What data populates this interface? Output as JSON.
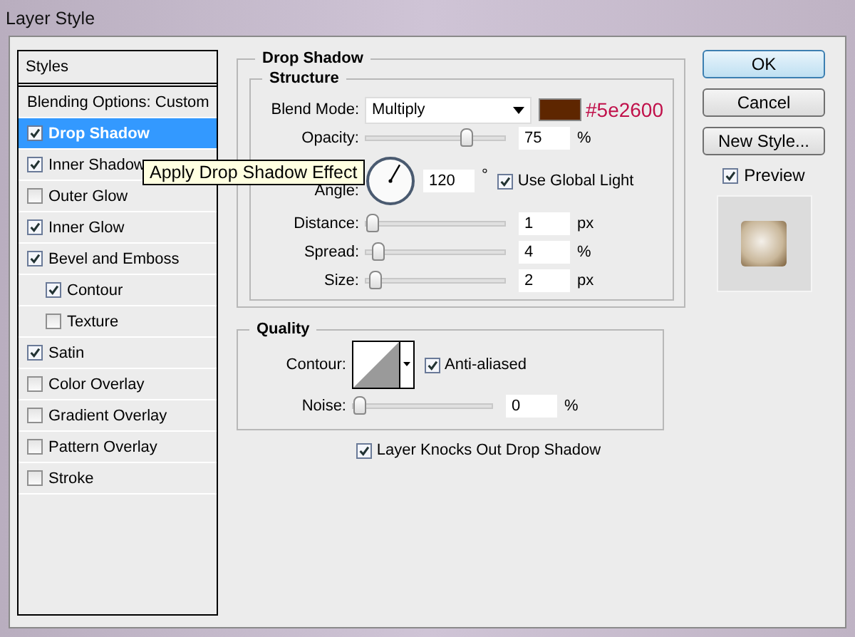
{
  "window": {
    "title": "Layer Style"
  },
  "styles": {
    "header": "Styles",
    "items": [
      {
        "label": "Blending Options: Custom",
        "kind": "plain",
        "selected": false
      },
      {
        "label": "Drop Shadow",
        "kind": "check",
        "checked": true,
        "selected": true
      },
      {
        "label": "Inner Shadow",
        "kind": "check",
        "checked": true,
        "selected": false
      },
      {
        "label": "Outer Glow",
        "kind": "check",
        "checked": false,
        "selected": false
      },
      {
        "label": "Inner Glow",
        "kind": "check",
        "checked": true,
        "selected": false
      },
      {
        "label": "Bevel and Emboss",
        "kind": "check",
        "checked": true,
        "selected": false,
        "children": [
          {
            "label": "Contour",
            "kind": "check",
            "checked": true,
            "selected": false
          },
          {
            "label": "Texture",
            "kind": "check",
            "checked": false,
            "selected": false
          }
        ]
      },
      {
        "label": "Satin",
        "kind": "check",
        "checked": true,
        "selected": false
      },
      {
        "label": "Color Overlay",
        "kind": "check",
        "checked": false,
        "selected": false
      },
      {
        "label": "Gradient Overlay",
        "kind": "check",
        "checked": false,
        "selected": false
      },
      {
        "label": "Pattern Overlay",
        "kind": "check",
        "checked": false,
        "selected": false
      },
      {
        "label": "Stroke",
        "kind": "check",
        "checked": false,
        "selected": false
      }
    ]
  },
  "tooltip": {
    "text": "Apply Drop Shadow Effect"
  },
  "drop_shadow": {
    "title": "Drop Shadow",
    "structure": {
      "title": "Structure",
      "blend_mode": {
        "label": "Blend Mode:",
        "value": "Multiply"
      },
      "annotation": "#5e2600",
      "opacity": {
        "label": "Opacity:",
        "level": 0.75,
        "value": "75",
        "unit": "%"
      },
      "angle": {
        "label": "Angle:",
        "value": "120",
        "unit": "°"
      },
      "use_global_light": {
        "label": "Use Global Light",
        "checked": true
      },
      "sliders": [
        {
          "label": "Distance:",
          "level": 0.0,
          "value": "1",
          "unit": "px"
        },
        {
          "label": "Spread:",
          "level": 0.04,
          "value": "4",
          "unit": "%"
        },
        {
          "label": "Size:",
          "level": 0.02,
          "value": "2",
          "unit": "px"
        }
      ]
    },
    "quality": {
      "title": "Quality",
      "contour_label": "Contour:",
      "anti_aliased": {
        "label": "Anti-aliased",
        "checked": true
      },
      "noise": {
        "label": "Noise:",
        "level": 0.0,
        "value": "0",
        "unit": "%"
      }
    },
    "layer_knocks_out": {
      "label": "Layer Knocks Out Drop Shadow",
      "checked": true
    }
  },
  "buttons": [
    "OK",
    "Cancel",
    "New Style..."
  ],
  "preview": {
    "label": "Preview",
    "checked": true
  }
}
